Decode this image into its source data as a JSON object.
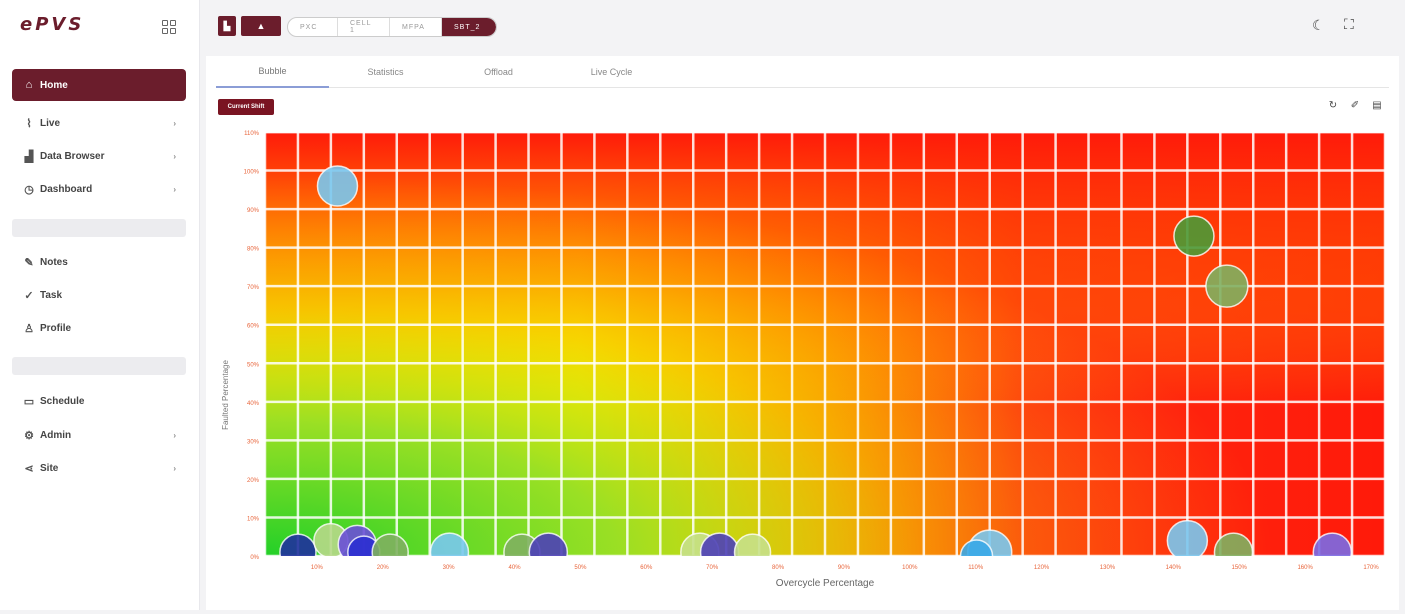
{
  "app": {
    "logo": "ePVS"
  },
  "sidebar": {
    "items": [
      {
        "label": "Home",
        "icon": "home-icon",
        "glyph": "⌂",
        "active": true,
        "chevron": false
      },
      {
        "label": "Live",
        "icon": "rss-icon",
        "glyph": "⌇",
        "chevron": true
      },
      {
        "label": "Data Browser",
        "icon": "bar-chart-icon",
        "glyph": "▟",
        "chevron": true
      },
      {
        "label": "Dashboard",
        "icon": "clock-icon",
        "glyph": "◷",
        "chevron": true
      },
      {
        "label": "Notes",
        "icon": "edit-icon",
        "glyph": "✎",
        "chevron": false
      },
      {
        "label": "Task",
        "icon": "check-circle-icon",
        "glyph": "✓",
        "chevron": false
      },
      {
        "label": "Profile",
        "icon": "user-icon",
        "glyph": "♙",
        "chevron": false
      },
      {
        "label": "Schedule",
        "icon": "calendar-icon",
        "glyph": "▭",
        "chevron": false
      },
      {
        "label": "Admin",
        "icon": "gear-icon",
        "glyph": "⚙",
        "chevron": true
      },
      {
        "label": "Site",
        "icon": "share-icon",
        "glyph": "⋖",
        "chevron": true
      }
    ]
  },
  "topbar": {
    "breadcrumbs": [
      "PXC",
      "CELL 1",
      "MFPA",
      "SBT_2"
    ]
  },
  "tabs": [
    "Bubble",
    "Statistics",
    "Offload",
    "Live Cycle"
  ],
  "active_tab": "Bubble",
  "action_button": "Current Shift",
  "chart_data": {
    "type": "scatter",
    "xlabel": "Overcycle Percentage",
    "ylabel": "Faulted Percentage",
    "x_ticks": [
      "10%",
      "20%",
      "30%",
      "40%",
      "50%",
      "60%",
      "70%",
      "80%",
      "90%",
      "100%",
      "110%",
      "120%",
      "130%",
      "140%",
      "150%",
      "160%",
      "170%"
    ],
    "y_ticks": [
      "0%",
      "10%",
      "20%",
      "30%",
      "40%",
      "50%",
      "60%",
      "70%",
      "80%",
      "90%",
      "100%",
      "110%"
    ],
    "xlim": [
      0,
      170
    ],
    "ylim": [
      0,
      110
    ],
    "colors": {
      "plot_hot": "#ff1a0a",
      "plot_warm": "#ffe600",
      "plot_cool": "#23d028",
      "tick_text": "#e8643a"
    },
    "points": [
      {
        "x": 11,
        "y": 96,
        "r": 20,
        "color": "#79c8f0"
      },
      {
        "x": 141,
        "y": 83,
        "r": 20,
        "color": "#4b9a36"
      },
      {
        "x": 146,
        "y": 70,
        "r": 21,
        "color": "#7fb060"
      },
      {
        "x": 5,
        "y": 1,
        "r": 18,
        "color": "#1f2f9e"
      },
      {
        "x": 10,
        "y": 4,
        "r": 17,
        "color": "#b7d88a"
      },
      {
        "x": 14,
        "y": 3,
        "r": 19,
        "color": "#6a4fd8"
      },
      {
        "x": 15,
        "y": 1,
        "r": 16,
        "color": "#2b2fd0"
      },
      {
        "x": 19,
        "y": 1,
        "r": 18,
        "color": "#7fb060"
      },
      {
        "x": 28,
        "y": 1,
        "r": 19,
        "color": "#79c8f0"
      },
      {
        "x": 39,
        "y": 1,
        "r": 18,
        "color": "#7fb060"
      },
      {
        "x": 43,
        "y": 1,
        "r": 19,
        "color": "#4c3fb8"
      },
      {
        "x": 66,
        "y": 1,
        "r": 19,
        "color": "#c6e08a"
      },
      {
        "x": 69,
        "y": 1,
        "r": 19,
        "color": "#4c3fb8"
      },
      {
        "x": 74,
        "y": 1,
        "r": 18,
        "color": "#c6e08a"
      },
      {
        "x": 110,
        "y": 1,
        "r": 22,
        "color": "#79c8f0"
      },
      {
        "x": 108,
        "y": 0,
        "r": 16,
        "color": "#3aa8e8"
      },
      {
        "x": 140,
        "y": 4,
        "r": 20,
        "color": "#79c8f0"
      },
      {
        "x": 147,
        "y": 1,
        "r": 19,
        "color": "#7fb060"
      },
      {
        "x": 162,
        "y": 1,
        "r": 19,
        "color": "#7a6be6"
      }
    ]
  }
}
